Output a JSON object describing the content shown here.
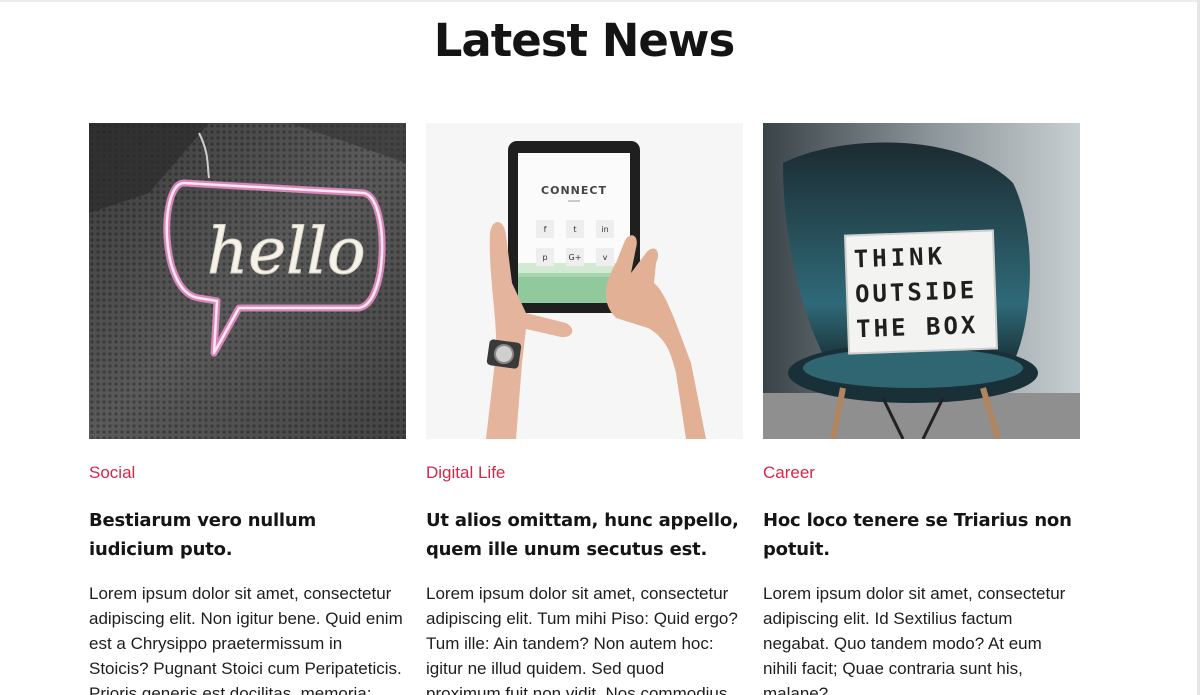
{
  "section": {
    "title": "Latest News"
  },
  "articles": [
    {
      "category": "Social",
      "headline": "Bestiarum vero nullum iudicium puto.",
      "excerpt": "Lorem ipsum dolor sit amet, consectetur adipiscing elit. Non igitur bene. Quid enim est a Chrysippo praetermissum in Stoicis? Pugnant Stoici cum Peripateticis. Prioris generis est docilitas, memoria;",
      "image": {
        "neon_text": "hello"
      }
    },
    {
      "category": "Digital Life",
      "headline": "Ut alios omittam, hunc appello, quem ille unum secutus est.",
      "excerpt": "Lorem ipsum dolor sit amet, consectetur adipiscing elit. Tum mihi Piso: Quid ergo? Tum ille: Ain tandem? Non autem hoc: igitur ne illud quidem. Sed quod proximum fuit non vidit. Nos commodius",
      "image": {
        "screen_text": "CONNECT",
        "icons": [
          "f",
          "t",
          "in",
          "p",
          "G+",
          "v"
        ]
      }
    },
    {
      "category": "Career",
      "headline": "Hoc loco tenere se Triarius non potuit.",
      "excerpt": "Lorem ipsum dolor sit amet, consectetur adipiscing elit. Id Sextilius factum negabat. Quo tandem modo? At eum nihili facit; Quae contraria sunt his, malane?",
      "image": {
        "lightbox_lines": [
          "THINK",
          "OUTSIDE",
          "THE BOX"
        ]
      }
    }
  ],
  "colors": {
    "accent": "#d2294a",
    "heading": "#141414",
    "body": "#1e1e1e"
  }
}
